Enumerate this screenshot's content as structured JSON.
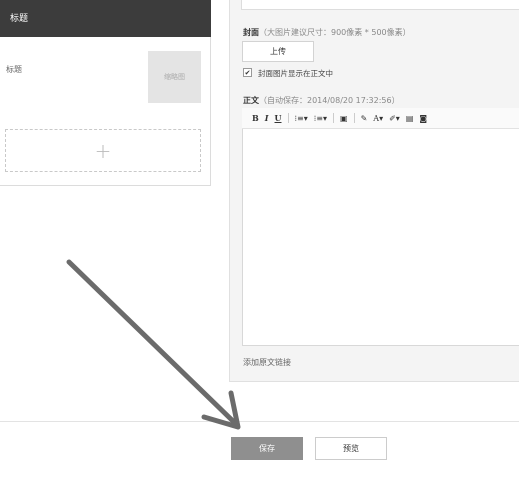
{
  "article_list": {
    "active_item_title": "标题",
    "sub_item_title": "标题",
    "thumbnail_label": "缩略图",
    "add_label": "+"
  },
  "editor": {
    "cover_label": "封面",
    "cover_hint": "（大图片建议尺寸：900像素 * 500像素）",
    "upload_label": "上传",
    "show_cover_checked": true,
    "show_cover_label": "封面图片显示在正文中",
    "body_label": "正文",
    "autosave_text": "（自动保存：2014/08/20 17:32:56）",
    "toolbar": {
      "bold": "B",
      "italic": "I",
      "underline": "U",
      "ordered_list": "⁝≡▾",
      "unordered_list": "⁝≡▾",
      "image": "▣",
      "pen": "✎",
      "font_color": "A▾",
      "highlight": "✐▾",
      "doc": "▤",
      "camera": "◙"
    },
    "add_source_link_label": "添加原文链接"
  },
  "footer": {
    "save_label": "保存",
    "preview_label": "预览"
  },
  "colors": {
    "dark_bar": "#3c3c3c",
    "save_button": "#8f8f8f",
    "arrow": "#6b6b6b"
  }
}
